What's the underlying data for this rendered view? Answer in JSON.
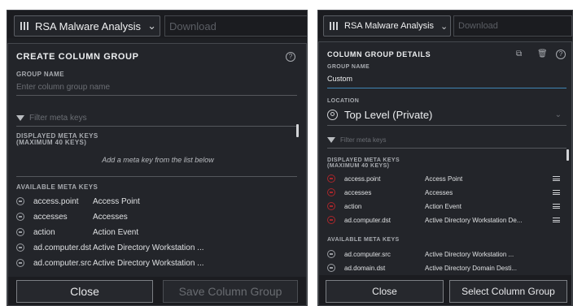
{
  "left": {
    "topbar": {
      "dropdown_label": "RSA Malware Analysis",
      "download_placeholder": "Download"
    },
    "dialog": {
      "title": "CREATE COLUMN GROUP",
      "help_glyph": "?",
      "group_name_label": "GROUP NAME",
      "group_name_placeholder": "Enter column group name",
      "filter_placeholder": "Filter meta keys",
      "displayed_label_line1": "DISPLAYED META KEYS",
      "displayed_label_line2": "(MAXIMUM 40 KEYS)",
      "empty_message": "Add a meta key from the list below",
      "available_label": "AVAILABLE META KEYS",
      "available_keys": [
        {
          "key": "access.point",
          "name": "Access Point"
        },
        {
          "key": "accesses",
          "name": "Accesses"
        },
        {
          "key": "action",
          "name": "Action Event"
        },
        {
          "key": "ad.computer.dst",
          "name": "Active Directory Workstation ..."
        },
        {
          "key": "ad.computer.src",
          "name": "Active Directory Workstation ..."
        }
      ],
      "close_label": "Close",
      "save_label": "Save Column Group"
    }
  },
  "right": {
    "topbar": {
      "dropdown_label": "RSA Malware Analysis",
      "download_placeholder": "Download"
    },
    "dialog": {
      "title": "COLUMN GROUP DETAILS",
      "help_glyph": "?",
      "group_name_label": "GROUP NAME",
      "group_name_value": "Custom",
      "location_label": "LOCATION",
      "location_value": "Top Level (Private)",
      "filter_placeholder": "Filter meta keys",
      "displayed_label_line1": "DISPLAYED META KEYS",
      "displayed_label_line2": "(MAXIMUM 40 KEYS)",
      "displayed_keys": [
        {
          "key": "access.point",
          "name": "Access Point"
        },
        {
          "key": "accesses",
          "name": "Accesses"
        },
        {
          "key": "action",
          "name": "Action Event"
        },
        {
          "key": "ad.computer.dst",
          "name": "Active Directory Workstation De..."
        }
      ],
      "available_label": "AVAILABLE META KEYS",
      "available_keys": [
        {
          "key": "ad.computer.src",
          "name": "Active Directory Workstation ..."
        },
        {
          "key": "ad.domain.dst",
          "name": "Active Directory Domain Desti..."
        }
      ],
      "close_label": "Close",
      "select_label": "Select Column Group"
    }
  },
  "colors": {
    "background": "#1e2024",
    "dialog": "#23252a",
    "remove_red": "#a8262b",
    "text": "#dfe1e3",
    "muted": "#6b6e74"
  }
}
